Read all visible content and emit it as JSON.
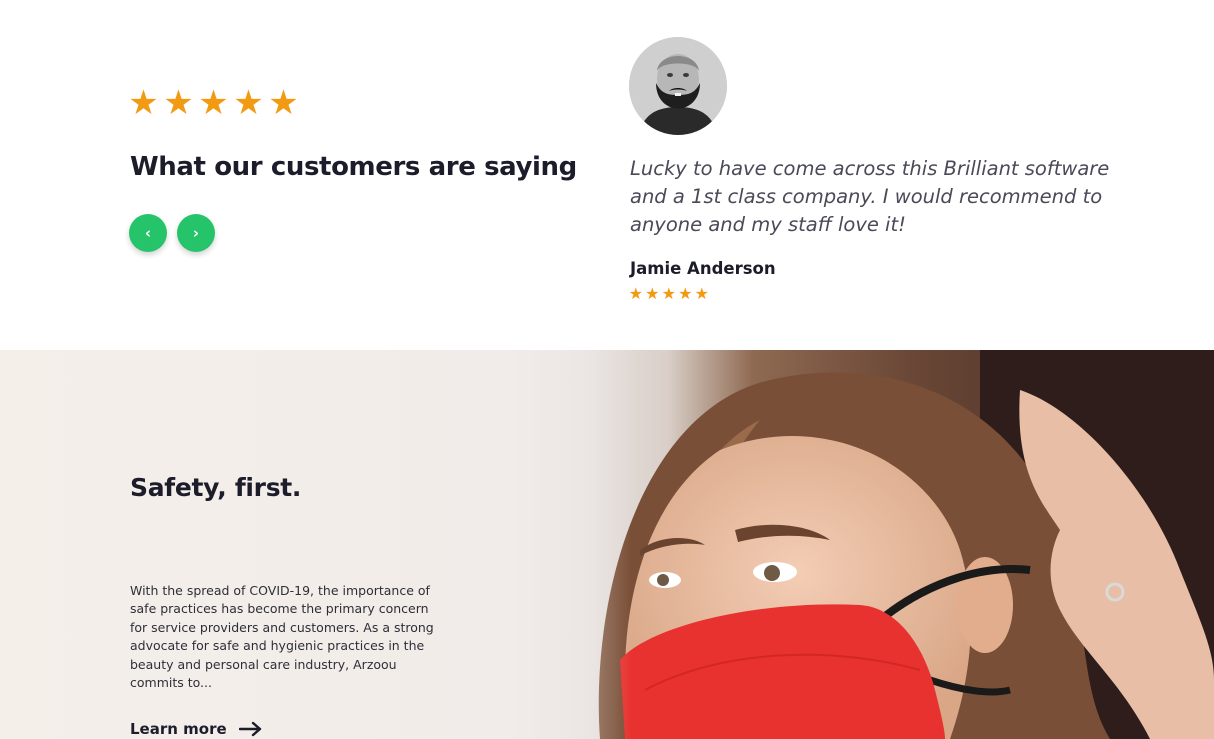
{
  "testimonials": {
    "heading": "What our customers are saying",
    "rating_stars": 5,
    "nav": {
      "prev_label": "‹",
      "next_label": "›"
    },
    "quote": "Lucky to have come across this Brilliant software and a 1st class company. I would recommend to anyone and my staff love it!",
    "author": "Jamie Anderson",
    "author_rating_stars": 5,
    "star_glyph": "★"
  },
  "safety": {
    "title": "Safety, first.",
    "body": "With the spread of COVID-19, the importance of safe practices has become the primary concern for service providers and customers. As a strong advocate for safe and hygienic practices in the beauty and personal care industry, Arzoou commits to...",
    "cta_label": "Learn more"
  },
  "colors": {
    "star": "#f29a12",
    "nav_button": "#25c46a",
    "heading": "#1c1c2b",
    "mask": "#e8322f"
  },
  "icons": {
    "prev": "chevron-left-icon",
    "next": "chevron-right-icon",
    "cta": "arrow-right-icon",
    "rating": "star-icon"
  }
}
